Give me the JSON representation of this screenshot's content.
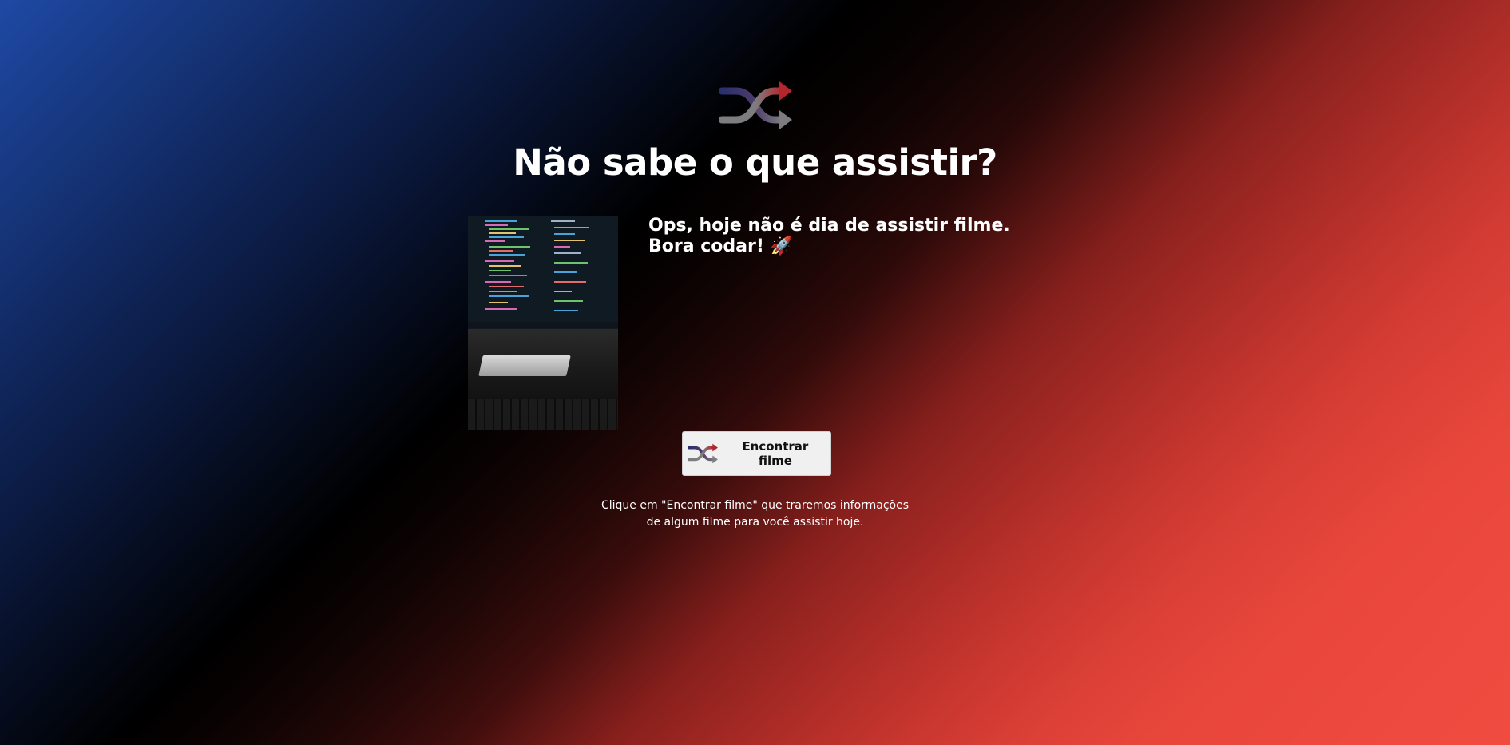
{
  "page": {
    "title": "Não sabe o que assistir?"
  },
  "logo": {
    "icon": "shuffle-icon",
    "colors": {
      "red": "#b3262b",
      "gray": "#7d7d80",
      "blue": "#2a2f6e"
    }
  },
  "movie": {
    "poster_icon": "coding-desk-image",
    "message": "Ops, hoje não é dia de assistir filme. Bora codar! 🚀"
  },
  "find_button": {
    "icon": "shuffle-icon",
    "label": "Encontrar filme"
  },
  "hint": {
    "line1": "Clique em \"Encontrar filme\" que traremos informações",
    "line2": "de algum filme para você assistir hoje."
  },
  "colors": {
    "background_red": "#c42a23",
    "background_blue": "#1e49a4",
    "background_black": "#000000",
    "button_bg": "#f0f0f0",
    "text": "#ffffff"
  }
}
